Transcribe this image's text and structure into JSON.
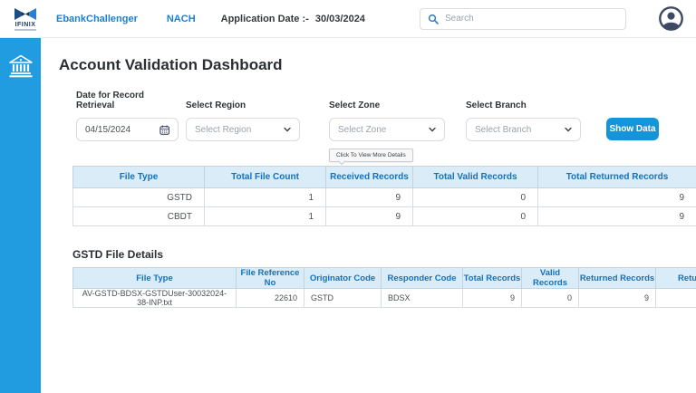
{
  "header": {
    "logo_text": "IFINIX",
    "brand": "EbankChallenger",
    "nav_nach": "NACH",
    "app_date_label": "Application Date :-",
    "app_date_value": "30/03/2024",
    "search_placeholder": "Search"
  },
  "page": {
    "title": "Account Validation Dashboard",
    "tooltip": "Click To View More Details"
  },
  "filters": {
    "date_label": "Date for Record Retrieval",
    "date_value": "04/15/2024",
    "region_label": "Select Region",
    "region_value": "Select Region",
    "zone_label": "Select Zone",
    "zone_value": "Select Zone",
    "branch_label": "Select Branch",
    "branch_value": "Select Branch",
    "show_data_label": "Show Data"
  },
  "summary_table": {
    "headers": [
      "File Type",
      "Total File Count",
      "Received Records",
      "Total Valid Records",
      "Total Returned Records"
    ],
    "rows": [
      {
        "file_type": "GSTD",
        "total_file_count": "1",
        "received_records": "9",
        "total_valid_records": "0",
        "total_returned_records": "9"
      },
      {
        "file_type": "CBDT",
        "total_file_count": "1",
        "received_records": "9",
        "total_valid_records": "0",
        "total_returned_records": "9"
      }
    ]
  },
  "details": {
    "title": "GSTD File Details",
    "headers": [
      "File Type",
      "File Reference No",
      "Originator Code",
      "Responder Code",
      "Total Records",
      "Valid Records",
      "Returned Records",
      "Retu"
    ],
    "rows": [
      {
        "file_type": "AV-GSTD-BDSX-GSTDUser-30032024-38-INP.txt",
        "file_reference_no": "22610",
        "originator_code": "GSTD",
        "responder_code": "BDSX",
        "total_records": "9",
        "valid_records": "0",
        "returned_records": "9",
        "retu": ""
      }
    ]
  },
  "colors": {
    "sidebar_blue": "#229ce0",
    "button_blue": "#1495d8",
    "brand_blue": "#1b7fd4",
    "table_header_bg": "#d9ecf8",
    "table_header_text": "#1272be",
    "link_blue": "#4961e0"
  }
}
